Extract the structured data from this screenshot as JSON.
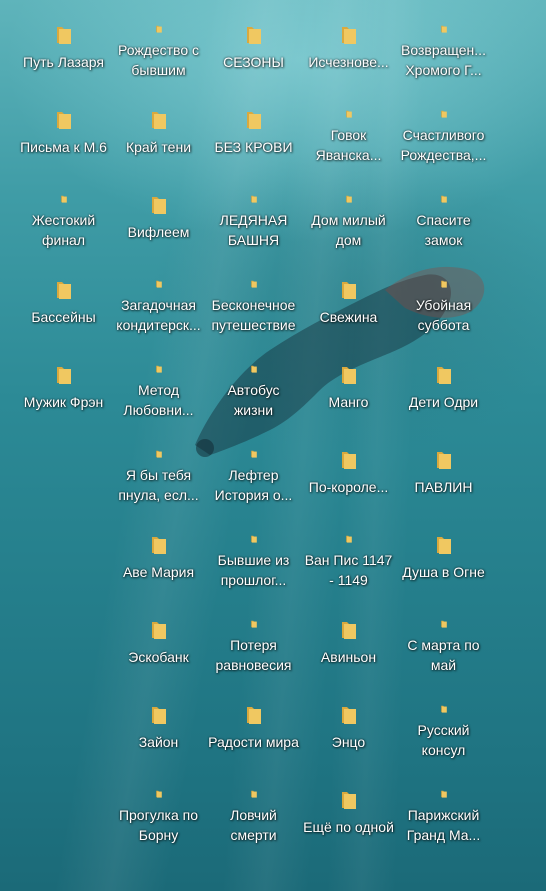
{
  "desktop": {
    "icon_name": "folder-icon",
    "folder_color": "#f0c861",
    "columns": [
      [
        "Путь Лазаря",
        "Письма к М.6",
        "Жестокий финал",
        "Бассейны",
        "Мужик Фрэн"
      ],
      [
        "Рождество с бывшим",
        "Край тени",
        "Вифлеем",
        "Загадочная кондитерск...",
        "Метод Любовни...",
        "Я бы тебя пнула, есл...",
        "Аве Мария",
        "Эскобанк",
        "Зайон",
        "Прогулка по Борну"
      ],
      [
        "СЕЗОНЫ",
        "БЕЗ КРОВИ",
        "ЛЕДЯНАЯ БАШНЯ",
        "Бесконечное путешествие",
        "Автобус жизни",
        "Лефтер История о...",
        "Бывшие из прошлог...",
        "Потеря равновесия",
        "Радости мира",
        "Ловчий смерти"
      ],
      [
        "Исчезнове...",
        "Говок Яванска...",
        "Дом милый дом",
        "Свежина",
        "Манго",
        "По-короле...",
        "Ван Пис 1147 - 1149",
        "Авиньон",
        "Энцо",
        "Ещё по одной"
      ],
      [
        "Возвращен... Хромого Г...",
        "Счастливого Рождества,...",
        "Спасите замок",
        "Убойная суббота",
        "Дети Одри",
        "ПАВЛИН",
        "Душа в Огне",
        "С марта по май",
        "Русский консул",
        "Парижский Гранд Ма..."
      ]
    ]
  }
}
